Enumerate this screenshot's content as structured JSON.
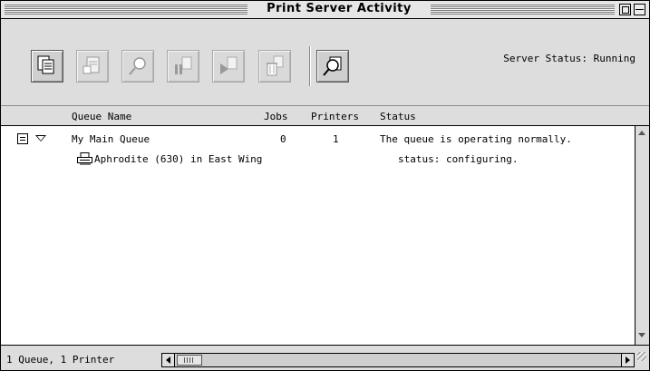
{
  "window": {
    "title": "Print Server Activity"
  },
  "toolbar": {
    "server_status": "Server Status: Running",
    "buttons": [
      {
        "name": "queue-info",
        "enabled": true
      },
      {
        "name": "new-queue",
        "enabled": false
      },
      {
        "name": "find",
        "enabled": false
      },
      {
        "name": "pause",
        "enabled": false
      },
      {
        "name": "resume",
        "enabled": false
      },
      {
        "name": "delete",
        "enabled": false
      },
      {
        "name": "monitor",
        "enabled": true
      }
    ]
  },
  "columns": {
    "queue_name": "Queue Name",
    "jobs": "Jobs",
    "printers": "Printers",
    "status": "Status"
  },
  "rows": [
    {
      "name": "My Main Queue",
      "jobs": "0",
      "printers": "1",
      "status": "The queue is operating normally."
    },
    {
      "name": "Aphrodite (630) in East Wing",
      "status": "status: configuring."
    }
  ],
  "footer": {
    "summary": "1 Queue, 1 Printer"
  }
}
